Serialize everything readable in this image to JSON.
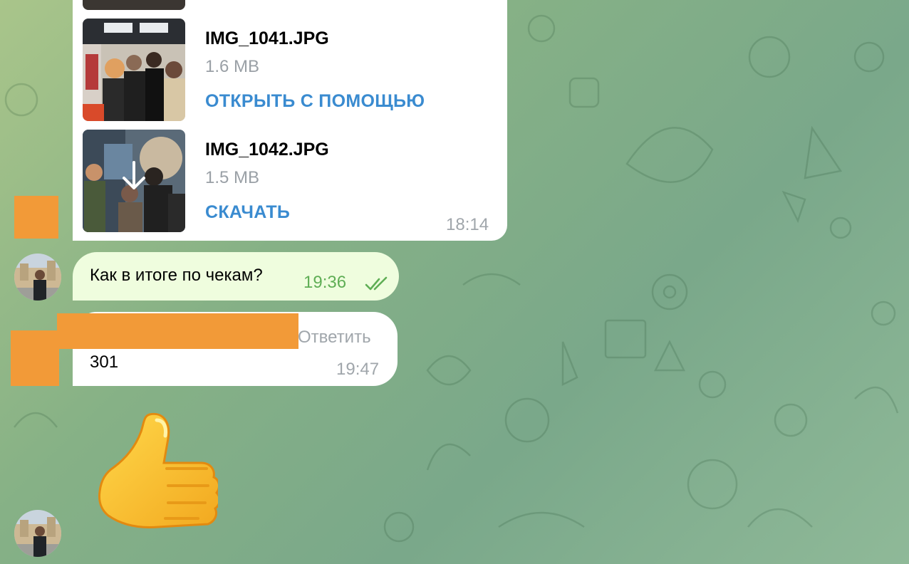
{
  "files": [
    {
      "name": "IMG_1041.JPG",
      "size": "1.6 MB",
      "action": "ОТКРЫТЬ С ПОМОЩЬЮ",
      "thumb_icon": "photo-thumbnail"
    },
    {
      "name": "IMG_1042.JPG",
      "size": "1.5 MB",
      "action": "СКАЧАТЬ",
      "thumb_icon": "download-arrow-icon"
    }
  ],
  "file_message_time": "18:14",
  "outgoing": {
    "text": "Как в итоге по чекам?",
    "time": "19:36",
    "status_icon": "double-check-icon"
  },
  "incoming": {
    "reply_label": "Ответить",
    "text": "301",
    "time": "19:47"
  },
  "sticker": {
    "icon": "thumbs-up-emoji"
  },
  "colors": {
    "link_blue": "#3a8bd0",
    "outgoing_bubble": "#effdde",
    "check_green": "#5fae55",
    "redaction_orange": "#f29a38"
  }
}
